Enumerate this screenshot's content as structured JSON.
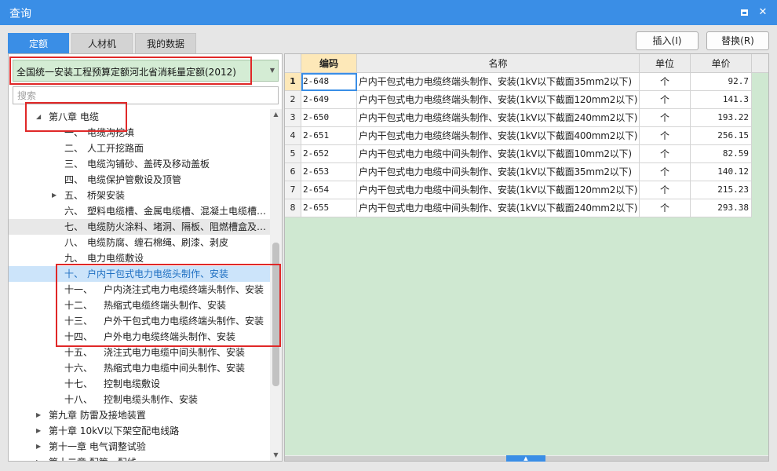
{
  "window": {
    "title": "查询",
    "maximize_icon": "maximize-icon",
    "close_icon": "close-icon",
    "close_glyph": "✕"
  },
  "tabs": [
    {
      "label": "定额",
      "active": true
    },
    {
      "label": "人材机",
      "active": false
    },
    {
      "label": "我的数据",
      "active": false
    }
  ],
  "actions": {
    "insert_label": "插入(I)",
    "replace_label": "替换(R)"
  },
  "quota_select": {
    "value": "全国统一安装工程预算定额河北省消耗量定额(2012)",
    "arrow_icon": "dropdown-arrow-icon",
    "arrow_glyph": "▼"
  },
  "search": {
    "placeholder": "搜索",
    "value": ""
  },
  "tree": {
    "expand_glyph": "▶",
    "collapse_glyph": "◢",
    "chapter": "第八章 电缆",
    "sections": [
      {
        "num": "一、",
        "text": "电缆沟挖填"
      },
      {
        "num": "二、",
        "text": "人工开挖路面"
      },
      {
        "num": "三、",
        "text": "电缆沟铺砂、盖砖及移动盖板"
      },
      {
        "num": "四、",
        "text": "电缆保护管敷设及顶管"
      },
      {
        "num": "五、",
        "text": "桥架安装",
        "expandable": true
      },
      {
        "num": "六、",
        "text": "塑料电缆槽、金属电缆槽、混凝土电缆槽…"
      },
      {
        "num": "七、",
        "text": "电缆防火涂料、堵洞、隔板、阻燃槽盒及…",
        "hovered": true
      },
      {
        "num": "八、",
        "text": "电缆防腐、缠石棉绳、刷漆、剥皮"
      },
      {
        "num": "九、",
        "text": "电力电缆敷设"
      },
      {
        "num": "十、",
        "text": "户内干包式电力电缆头制作、安装",
        "selected": true
      },
      {
        "num": "十一、",
        "text": "户内浇注式电力电缆终端头制作、安装"
      },
      {
        "num": "十二、",
        "text": "热缩式电缆终端头制作、安装"
      },
      {
        "num": "十三、",
        "text": "户外干包式电力电缆终端头制作、安装"
      },
      {
        "num": "十四、",
        "text": "户外电力电缆终端头制作、安装"
      },
      {
        "num": "十五、",
        "text": "浇注式电力电缆中间头制作、安装"
      },
      {
        "num": "十六、",
        "text": "热缩式电力电缆中间头制作、安装"
      },
      {
        "num": "十七、",
        "text": "控制电缆敷设"
      },
      {
        "num": "十八、",
        "text": "控制电缆头制作、安装"
      }
    ],
    "other_chapters": [
      "第九章 防雷及接地装置",
      "第十章 10kV以下架空配电线路",
      "第十一章 电气调整试验",
      "第十二章 配管、配线"
    ]
  },
  "table": {
    "columns": [
      "编码",
      "名称",
      "单位",
      "单价"
    ],
    "rows": [
      {
        "idx": "1",
        "code": "2-648",
        "name": "户内干包式电力电缆终端头制作、安装(1kV以下截面35mm2以下)",
        "unit": "个",
        "price": "92.7"
      },
      {
        "idx": "2",
        "code": "2-649",
        "name": "户内干包式电力电缆终端头制作、安装(1kV以下截面120mm2以下)",
        "unit": "个",
        "price": "141.3"
      },
      {
        "idx": "3",
        "code": "2-650",
        "name": "户内干包式电力电缆终端头制作、安装(1kV以下截面240mm2以下)",
        "unit": "个",
        "price": "193.22"
      },
      {
        "idx": "4",
        "code": "2-651",
        "name": "户内干包式电力电缆终端头制作、安装(1kV以下截面400mm2以下)",
        "unit": "个",
        "price": "256.15"
      },
      {
        "idx": "5",
        "code": "2-652",
        "name": "户内干包式电力电缆中间头制作、安装(1kV以下截面10mm2以下)",
        "unit": "个",
        "price": "82.59"
      },
      {
        "idx": "6",
        "code": "2-653",
        "name": "户内干包式电力电缆中间头制作、安装(1kV以下截面35mm2以下)",
        "unit": "个",
        "price": "140.12"
      },
      {
        "idx": "7",
        "code": "2-654",
        "name": "户内干包式电力电缆中间头制作、安装(1kV以下截面120mm2以下)",
        "unit": "个",
        "price": "215.23"
      },
      {
        "idx": "8",
        "code": "2-655",
        "name": "户内干包式电力电缆中间头制作、安装(1kV以下截面240mm2以下)",
        "unit": "个",
        "price": "293.38"
      }
    ]
  },
  "scrollbar": {
    "up_glyph": "▲",
    "down_glyph": "▼"
  },
  "splitter": {
    "glyph": "▲"
  },
  "colors": {
    "accent": "#3a8ee6",
    "highlight_box": "#e02828",
    "grid_background": "#cfe8d1",
    "selected_tree_text": "#1e6fc2"
  }
}
